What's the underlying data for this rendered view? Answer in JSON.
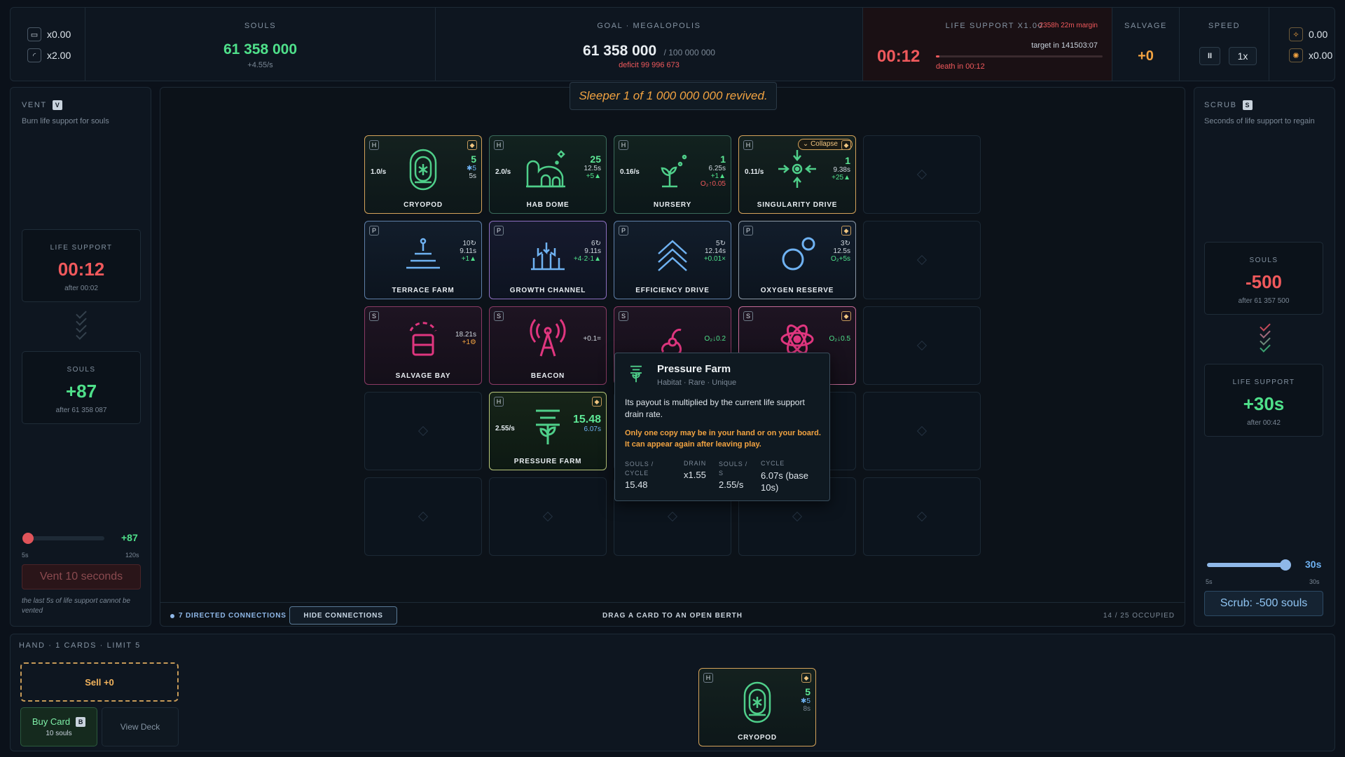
{
  "top": {
    "left_mult1": "x0.00",
    "left_mult2": "x2.00",
    "souls_label": "SOULS",
    "souls_value": "61 358 000",
    "souls_rate": "+4.55/s",
    "goal_label": "GOAL · MEGALOPOLIS",
    "goal_value": "61 358 000",
    "goal_target": "/ 100 000 000",
    "goal_deficit": "deficit 99 996 673",
    "ls_label": "LIFE SUPPORT X1.00",
    "ls_margin": "-2358h 22m margin",
    "ls_time": "00:12",
    "ls_target": "target in 141503:07",
    "ls_death": "death in 00:12",
    "salvage_label": "SALVAGE",
    "salvage_value": "+0",
    "speed_label": "SPEED",
    "speed_pause": "II",
    "speed_value": "1x",
    "right_mult1": "0.00",
    "right_mult2": "x0.00"
  },
  "vent": {
    "title": "VENT",
    "key": "V",
    "desc": "Burn life support for souls",
    "ls_label": "LIFE SUPPORT",
    "ls_value": "00:12",
    "ls_after": "after 00:02",
    "souls_label": "SOULS",
    "souls_value": "+87",
    "souls_after": "after 61 358 087",
    "slider_value": "+87",
    "slider_level": 0.06,
    "min": "5s",
    "max": "120s",
    "button": "Vent 10 seconds",
    "note": "the last 5s of life support cannot be vented"
  },
  "scrub": {
    "title": "SCRUB",
    "key": "S",
    "desc": "Seconds of life support to regain",
    "souls_label": "SOULS",
    "souls_value": "-500",
    "souls_after": "after 61 357 500",
    "ls_label": "LIFE SUPPORT",
    "ls_value": "+30s",
    "ls_after": "after 00:42",
    "slider_value": "30s",
    "slider_level": 1.0,
    "min": "5s",
    "max": "30s",
    "button": "Scrub: -500 souls"
  },
  "banner": "Sleeper 1 of 1 000 000 000 revived.",
  "cards": {
    "cryopod": {
      "tag": "H",
      "rate": "1.0/s",
      "s1": "5",
      "s2": "✱5",
      "s3": "5s",
      "name": "CRYOPOD"
    },
    "habdome": {
      "tag": "H",
      "rate": "2.0/s",
      "s1": "25",
      "s2": "12.5s",
      "s3": "+5▲",
      "name": "HAB DOME"
    },
    "nursery": {
      "tag": "H",
      "rate": "0.16/s",
      "s1": "1",
      "s2": "6.25s",
      "s3": "+1▲",
      "s4": "O₂↑0.05",
      "name": "NURSERY"
    },
    "singularity": {
      "tag": "H",
      "rate": "0.11/s",
      "s1": "1",
      "s2": "9.38s",
      "s3": "+25▲",
      "collapse": "⌄ Collapse",
      "name": "SINGULARITY DRIVE"
    },
    "terrace": {
      "tag": "P",
      "s1": "10↻",
      "s2": "9.11s",
      "s3": "+1▲",
      "name": "TERRACE FARM"
    },
    "growth": {
      "tag": "P",
      "s1": "6↻",
      "s2": "9.11s",
      "s3": "+4·2·1▲",
      "name": "GROWTH CHANNEL"
    },
    "efficiency": {
      "tag": "P",
      "s1": "5↻",
      "s2": "12.14s",
      "s3": "+0.01×",
      "name": "EFFICIENCY DRIVE"
    },
    "oxygen": {
      "tag": "P",
      "s1": "3↻",
      "s2": "12.5s",
      "s3": "O₂+5s",
      "name": "OXYGEN RESERVE"
    },
    "salvagebay": {
      "tag": "S",
      "s1": "18.21s",
      "s2": "+1⚙",
      "name": "SALVAGE BAY"
    },
    "beacon": {
      "tag": "S",
      "s1": "+0.1=",
      "name": "BEACON"
    },
    "s3card": {
      "tag": "S",
      "s1": "O₂↓0.2"
    },
    "fusion": {
      "tag": "S",
      "s1": "O₂↓0.5",
      "name": "FUSION CORE"
    },
    "pressure": {
      "tag": "H",
      "rate": "2.55/s",
      "s1": "15.48",
      "s2": "6.07s",
      "name": "PRESSURE FARM"
    }
  },
  "tooltip": {
    "title": "Pressure Farm",
    "sub": "Habitat · Rare · Unique",
    "desc": "Its payout is multiplied by the current life support drain rate.",
    "warn": "Only one copy may be in your hand or on your board. It can appear again after leaving play.",
    "h1": "SOULS / CYCLE",
    "v1": "15.48",
    "h2": "DRAIN",
    "v2": "x1.55",
    "h3": "SOULS / S",
    "v3": "2.55/s",
    "h4": "CYCLE",
    "v4": "6.07s (base 10s)"
  },
  "board_footer": {
    "connections": "7 DIRECTED CONNECTIONS",
    "hide": "HIDE CONNECTIONS",
    "drag": "DRAG A CARD TO AN OPEN BERTH",
    "occupied": "14 / 25 OCCUPIED"
  },
  "hand": {
    "label": "HAND · 1 CARDS · LIMIT 5",
    "sell": "Sell +0",
    "buy": "Buy Card",
    "buy_key": "B",
    "buy_cost": "10 souls",
    "view": "View Deck",
    "card": {
      "tag": "H",
      "s1": "5",
      "s2": "✱5",
      "s3": "8s",
      "name": "CRYOPOD"
    }
  },
  "colors": {
    "accent_green": "#4fe08a",
    "danger": "#f0595c",
    "gold": "#d4a25a",
    "salvage_pink": "#e0367f"
  }
}
